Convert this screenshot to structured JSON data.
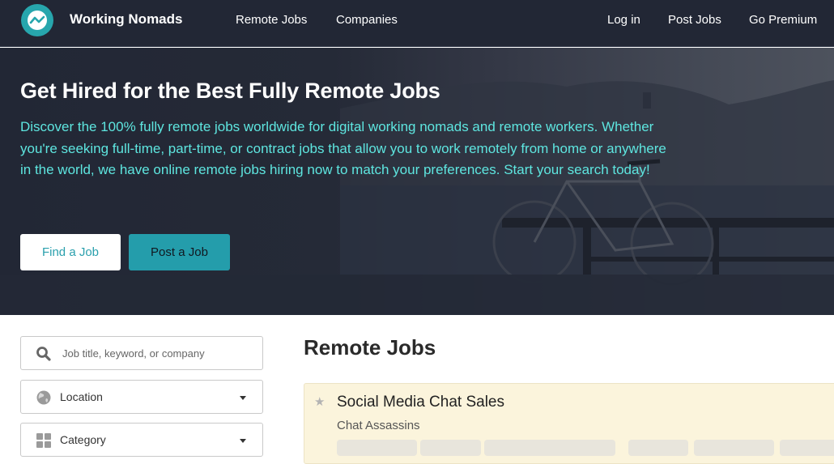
{
  "navbar": {
    "brand": "Working Nomads",
    "logo_icon": "trend-line-logo-icon",
    "links_left": [
      "Remote Jobs",
      "Companies"
    ],
    "links_right": [
      "Log in",
      "Post Jobs",
      "Go Premium"
    ]
  },
  "hero": {
    "title": "Get Hired for the Best Fully Remote Jobs",
    "description": "Discover the 100% fully remote jobs worldwide for digital working nomads and remote workers. Whether you're seeking full-time, part-time, or contract jobs that allow you to work remotely from home or anywhere in the world, we have online remote jobs hiring now to match your preferences. Start your search today!",
    "find_button": "Find a Job",
    "post_button": "Post a Job"
  },
  "filters": {
    "search_placeholder": "Job title, keyword, or company",
    "location_label": "Location",
    "category_label": "Category"
  },
  "main": {
    "title": "Remote Jobs",
    "jobs": [
      {
        "title": "Social Media Chat Sales",
        "company": "Chat Assassins",
        "featured": true
      }
    ]
  },
  "colors": {
    "nav_bg": "#222735",
    "accent": "#27a6ad",
    "hero_text": "#5ee6e0",
    "featured_bg": "#fbf4dc"
  }
}
